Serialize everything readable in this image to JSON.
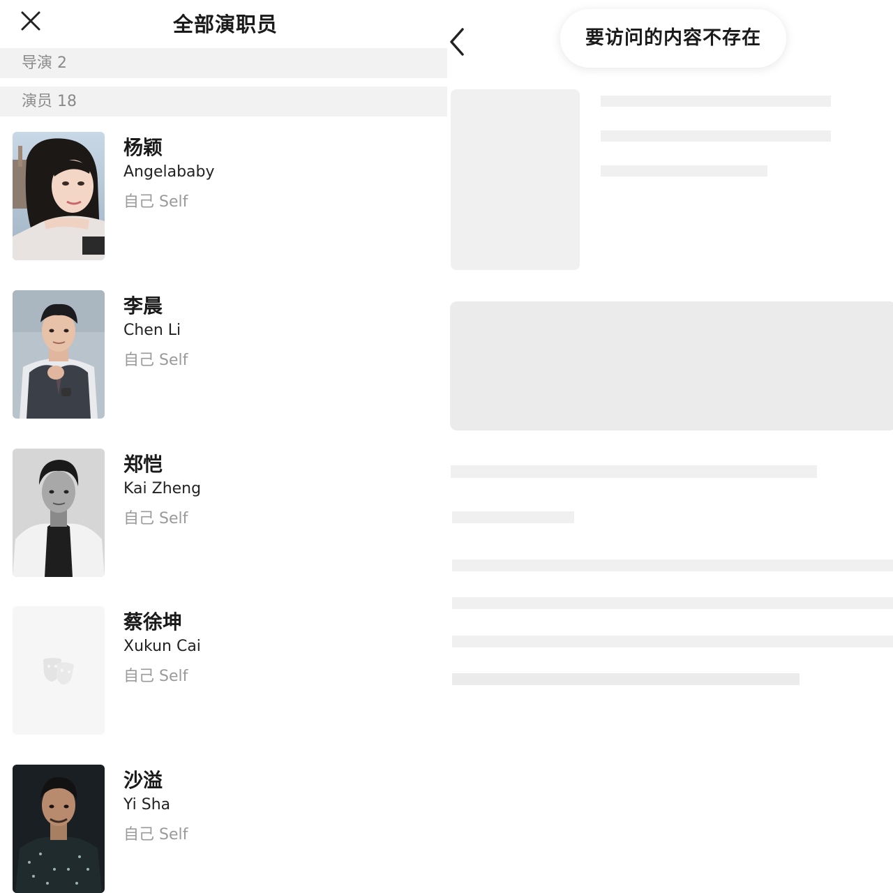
{
  "header": {
    "title": "全部演职员"
  },
  "sections": {
    "directors": "导演 2",
    "actors": "演员 18"
  },
  "cast": [
    {
      "cn_name": "杨颖",
      "en_name": "Angelababy",
      "role": "自己 Self",
      "photo": "photo"
    },
    {
      "cn_name": "李晨",
      "en_name": "Chen Li",
      "role": "自己 Self",
      "photo": "photo"
    },
    {
      "cn_name": "郑恺",
      "en_name": "Kai Zheng",
      "role": "自己 Self",
      "photo": "photo-bw"
    },
    {
      "cn_name": "蔡徐坤",
      "en_name": "Xukun Cai",
      "role": "自己 Self",
      "photo": "theater-masks-placeholder-icon"
    },
    {
      "cn_name": "沙溢",
      "en_name": "Yi Sha",
      "role": "自己 Self",
      "photo": "photo"
    }
  ],
  "detail": {
    "toast": "要访问的内容不存在",
    "state": "loading-skeleton"
  },
  "icons": {
    "close": "close-icon",
    "back": "chevron-left-icon"
  },
  "colors": {
    "section_bg": "#f2f2f2",
    "skeleton": "#f0f0f0",
    "muted_text": "#9a9a9a"
  }
}
